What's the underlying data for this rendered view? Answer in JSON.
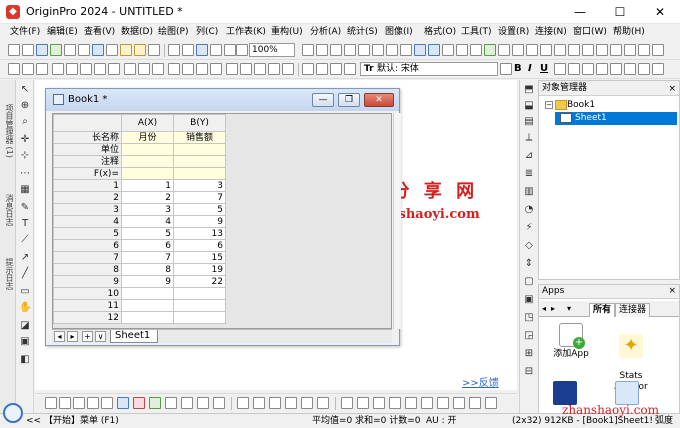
{
  "window": {
    "title": "OriginPro 2024 - UNTITLED *",
    "app_icon": "origin-logo-icon",
    "minimize": "—",
    "maximize": "☐",
    "close": "✕"
  },
  "menu": [
    "文件(F)",
    "编辑(E)",
    "查看(V)",
    "数据(D)",
    "绘图(P)",
    "列(C)",
    "工作表(K)",
    "重构(U)",
    "分析(A)",
    "统计(S)",
    "图像(I)",
    "格式(O)",
    "工具(T)",
    "设置(R)",
    "连接(N)",
    "窗口(W)",
    "帮助(H)"
  ],
  "toolbar": {
    "zoom": "100%",
    "font": "默认: 宋体",
    "font_icon": "Tr",
    "bold": "B",
    "italic": "I",
    "underline": "U"
  },
  "workspace": {
    "watermark_title": "我 爱 分 享 网",
    "watermark_url": "www.zhanshaoyi.com",
    "feedback": ">>反馈"
  },
  "book": {
    "title": "Book1 *",
    "min": "—",
    "restore": "❐",
    "close": "✕",
    "col_headers": [
      "A(X)",
      "B(Y)"
    ],
    "meta_rows": [
      {
        "label": "长名称",
        "a": "月份",
        "b": "销售额"
      },
      {
        "label": "单位",
        "a": "",
        "b": ""
      },
      {
        "label": "注释",
        "a": "",
        "b": ""
      },
      {
        "label": "F(x)=",
        "a": "",
        "b": ""
      }
    ],
    "rows": [
      {
        "n": "1",
        "a": "1",
        "b": "3"
      },
      {
        "n": "2",
        "a": "2",
        "b": "7"
      },
      {
        "n": "3",
        "a": "3",
        "b": "5"
      },
      {
        "n": "4",
        "a": "4",
        "b": "9"
      },
      {
        "n": "5",
        "a": "5",
        "b": "13"
      },
      {
        "n": "6",
        "a": "6",
        "b": "6"
      },
      {
        "n": "7",
        "a": "7",
        "b": "15"
      },
      {
        "n": "8",
        "a": "8",
        "b": "19"
      },
      {
        "n": "9",
        "a": "9",
        "b": "22"
      },
      {
        "n": "10",
        "a": "",
        "b": ""
      },
      {
        "n": "11",
        "a": "",
        "b": ""
      },
      {
        "n": "12",
        "a": "",
        "b": ""
      }
    ],
    "sheet_tab": "Sheet1",
    "nav": [
      "◂",
      "▸",
      "+",
      "∨"
    ]
  },
  "left_strip": {
    "tabs": [
      "项目管理器 (1)",
      "消息日志",
      "提示日志"
    ]
  },
  "object_manager": {
    "title": "对象管理器",
    "close": "×",
    "book": "Book1",
    "sheet": "Sheet1"
  },
  "apps": {
    "title": "Apps",
    "close": "×",
    "tabs": [
      "所有",
      "连接器"
    ],
    "items": [
      "添加App",
      "Stats\nAdvisor"
    ]
  },
  "status": {
    "start": "【开始】菜单 (F1)",
    "stats": "平均值=0 求和=0 计数=0",
    "au": "AU : 开",
    "pos": "(2x32) 9",
    "info": "12KB - [Book1]Sheet1!",
    "unit": "弧度",
    "nav_arrows": "<<"
  },
  "corner_watermark": "zhanshaoyi.com",
  "colors": {
    "accent": "#0078d7",
    "meta_bg": "#ffffe0",
    "watermark": "#d51f1f"
  }
}
